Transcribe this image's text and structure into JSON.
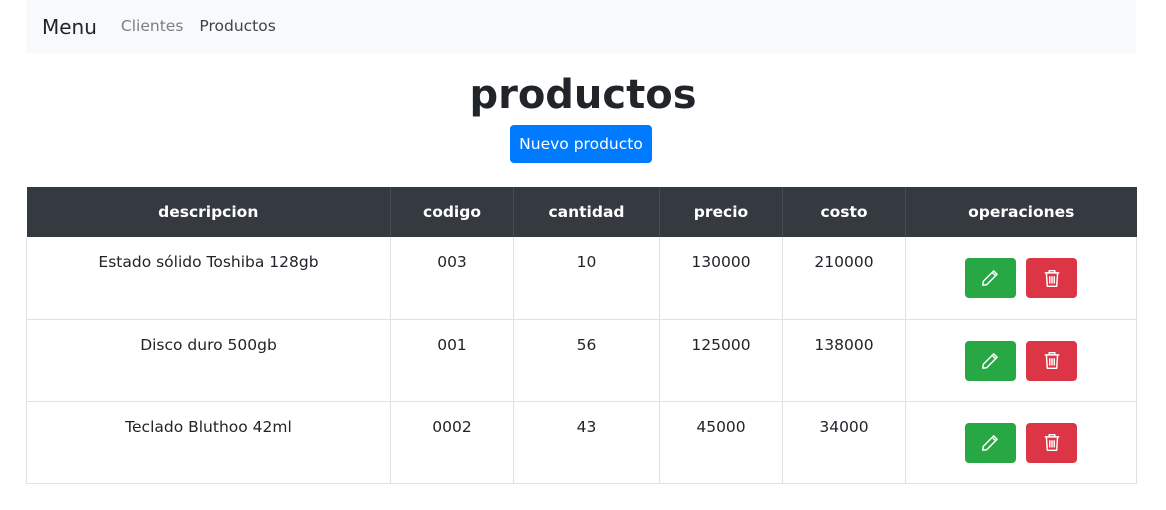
{
  "navbar": {
    "brand": "Menu",
    "links": [
      {
        "label": "Clientes"
      },
      {
        "label": "Productos"
      }
    ]
  },
  "page": {
    "title": "productos",
    "new_button": "Nuevo producto"
  },
  "table": {
    "headers": [
      "descripcion",
      "codigo",
      "cantidad",
      "precio",
      "costo",
      "operaciones"
    ],
    "rows": [
      {
        "descripcion": "Estado sólido Toshiba 128gb",
        "codigo": "003",
        "cantidad": "10",
        "precio": "130000",
        "costo": "210000"
      },
      {
        "descripcion": "Disco duro 500gb",
        "codigo": "001",
        "cantidad": "56",
        "precio": "125000",
        "costo": "138000"
      },
      {
        "descripcion": "Teclado Bluthoo 42ml",
        "codigo": "0002",
        "cantidad": "43",
        "precio": "45000",
        "costo": "34000"
      }
    ],
    "row_actions": {
      "edit_icon": "pencil-icon",
      "delete_icon": "trash-icon"
    }
  },
  "colors": {
    "primary": "#007bff",
    "success": "#28a745",
    "danger": "#dc3545",
    "table_header": "#343a40",
    "navbar_bg": "#f8f9fa"
  }
}
